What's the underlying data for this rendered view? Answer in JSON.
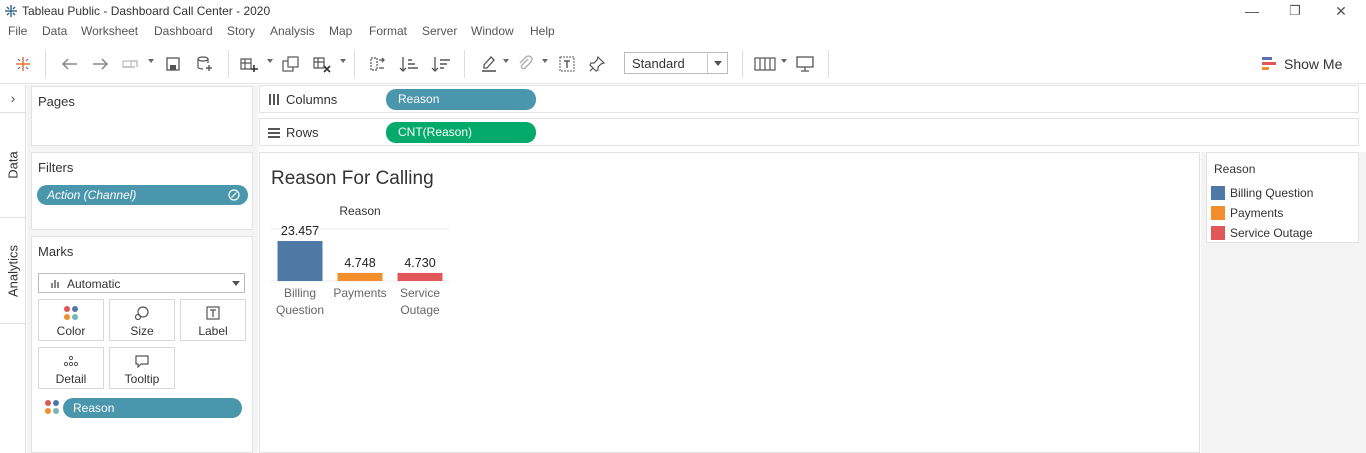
{
  "window": {
    "title": "Tableau Public - Dashboard Call Center - 2020",
    "minimize": "—",
    "restore": "❐",
    "close": "✕"
  },
  "menu": [
    "File",
    "Data",
    "Worksheet",
    "Dashboard",
    "Story",
    "Analysis",
    "Map",
    "Format",
    "Server",
    "Window",
    "Help"
  ],
  "toolbar": {
    "fit_select": "Standard",
    "show_me": "Show Me"
  },
  "side_tabs": {
    "expand": "›",
    "data": "Data",
    "analytics": "Analytics"
  },
  "pages": {
    "title": "Pages"
  },
  "filters": {
    "title": "Filters",
    "items": [
      "Action (Channel)"
    ]
  },
  "marks": {
    "title": "Marks",
    "mark_type": "Automatic",
    "cards": [
      {
        "label": "Color",
        "icon": "color-icon"
      },
      {
        "label": "Size",
        "icon": "size-icon"
      },
      {
        "label": "Label",
        "icon": "label-icon"
      },
      {
        "label": "Detail",
        "icon": "detail-icon"
      },
      {
        "label": "Tooltip",
        "icon": "tooltip-icon"
      }
    ],
    "field_pill": "Reason"
  },
  "shelves": {
    "columns_label": "Columns",
    "columns_pill": "Reason",
    "rows_label": "Rows",
    "rows_pill": "CNT(Reason)"
  },
  "sheet": {
    "title": "Reason For Calling"
  },
  "legend": {
    "title": "Reason",
    "items": [
      {
        "label": "Billing Question",
        "color": "#4e79a7"
      },
      {
        "label": "Payments",
        "color": "#f28e2b"
      },
      {
        "label": "Service Outage",
        "color": "#e15759"
      }
    ]
  },
  "chart_data": {
    "type": "bar",
    "column_header": "Reason",
    "categories": [
      "Billing Question",
      "Payments",
      "Service Outage"
    ],
    "category_lines": [
      [
        "Billing",
        "Question"
      ],
      [
        "Payments"
      ],
      [
        "Service",
        "Outage"
      ]
    ],
    "values": [
      23457,
      4748,
      4730
    ],
    "data_labels": [
      "23.457",
      "4.748",
      "4.730"
    ],
    "colors": [
      "#4e79a7",
      "#f28e2b",
      "#e15759"
    ]
  }
}
